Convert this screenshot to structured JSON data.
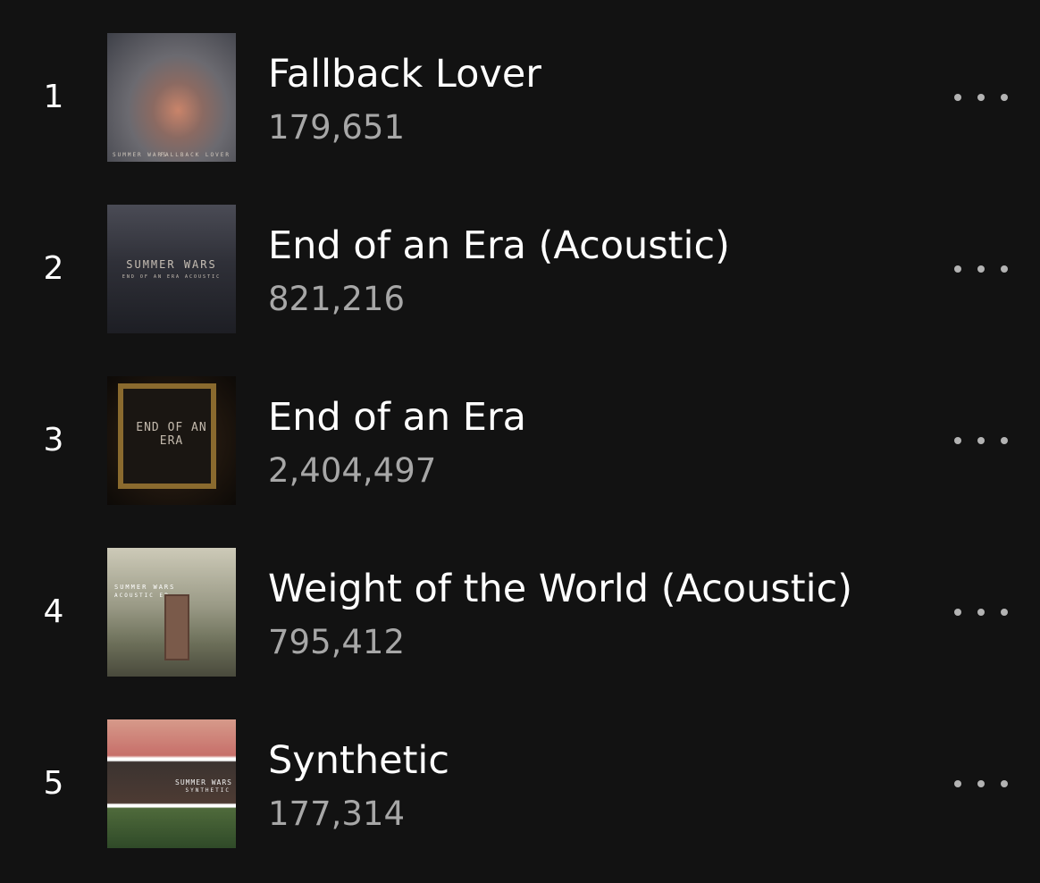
{
  "tracks": [
    {
      "rank": "1",
      "title": "Fallback Lover",
      "plays": "179,651",
      "art_band": "SUMMER WARS",
      "art_album": "FALLBACK LOVER"
    },
    {
      "rank": "2",
      "title": "End of an Era (Acoustic)",
      "plays": "821,216",
      "art_band": "SUMMER WARS",
      "art_album": "END OF AN ERA ACOUSTIC"
    },
    {
      "rank": "3",
      "title": "End of an Era",
      "plays": "2,404,497",
      "art_band": "END OF AN ERA",
      "art_album": ""
    },
    {
      "rank": "4",
      "title": "Weight of the World (Acoustic)",
      "plays": "795,412",
      "art_band": "SUMMER WARS",
      "art_album": "ACOUSTIC EP"
    },
    {
      "rank": "5",
      "title": "Synthetic",
      "plays": "177,314",
      "art_band": "SUMMER WARS",
      "art_album": "SYNTHETIC"
    }
  ],
  "icons": {
    "more": "more-options-icon"
  }
}
